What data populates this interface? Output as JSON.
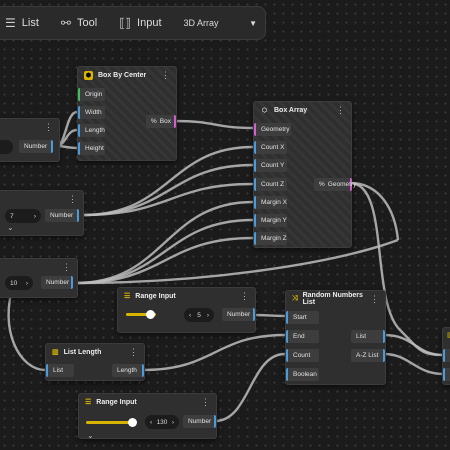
{
  "toolbar": {
    "list_label": "List",
    "tool_label": "Tool",
    "input_label": "Input",
    "dropdown_value": "3D Array"
  },
  "box_by_center": {
    "title": "Box By Center",
    "inputs": [
      "Origin",
      "Width",
      "Length",
      "Height"
    ],
    "output": "Box"
  },
  "box_array": {
    "title": "Box Array",
    "inputs": [
      "Geometry",
      "Count X",
      "Count Y",
      "Count Z",
      "Margin X",
      "Margin Y",
      "Margin Z"
    ],
    "output": "Geometry"
  },
  "left_number_1": {
    "output": "Number"
  },
  "left_number_2": {
    "value": "7",
    "output": "Number"
  },
  "left_number_3": {
    "value": "10",
    "output": "Number"
  },
  "range_input_1": {
    "title": "Range Input",
    "value": "5",
    "output": "Number",
    "slider_fraction": 0.6
  },
  "range_input_2": {
    "title": "Range Input",
    "value": "130",
    "output": "Number",
    "slider_fraction": 0.6
  },
  "list_length": {
    "title": "List Length",
    "input": "List",
    "output": "Length"
  },
  "random_numbers": {
    "title": "Random Numbers List",
    "inputs": [
      "Start",
      "End",
      "Count",
      "Boolean"
    ],
    "outputs": [
      "List",
      "A-Z List"
    ]
  },
  "colors": {
    "accent_blue": "#4a9bd8",
    "accent_pink": "#d05fd0",
    "accent_yellow": "#d9b400",
    "accent_green": "#3fbf5a"
  }
}
